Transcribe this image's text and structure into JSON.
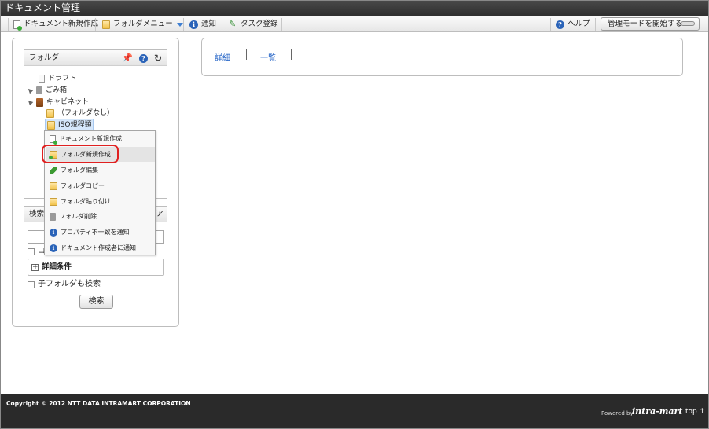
{
  "window": {
    "title": "ドキュメント管理"
  },
  "toolbar": {
    "new_doc": "ドキュメント新規作成",
    "folder_menu": "フォルダメニュー",
    "notify": "通知",
    "task": "タスク登録",
    "help": "ヘルプ",
    "admin_mode": "管理モードを開始する"
  },
  "folder_panel": {
    "title": "フォルダ",
    "tree": {
      "draft": "ドラフト",
      "trash": "ごみ箱",
      "cabinet": "キャビネット",
      "no_folder": "（フォルダなし）",
      "iso": "ISO規程類"
    }
  },
  "context_menu": {
    "items": [
      "ドキュメント新規作成",
      "フォルダ新規作成",
      "フォルダ編集",
      "フォルダコピー",
      "フォルダ貼り付け",
      "フォルダ削除",
      "プロパティ不一致を通知",
      "ドキュメント作成者に通知"
    ]
  },
  "search_panel": {
    "title": "検索",
    "header_tail": "ア",
    "check1_partial": "コ",
    "detail_conditions": "詳細条件",
    "include_subfolders": "子フォルダも検索",
    "search_button": "検索"
  },
  "content": {
    "tab_detail": "詳細",
    "tab_list": "一覧",
    "tab_sep": "|"
  },
  "footer": {
    "copyright": "Copyright © 2012 NTT DATA INTRAMART CORPORATION",
    "powered_by": "Powered by",
    "logo": "intra-mart",
    "top_link": "top ↑"
  }
}
